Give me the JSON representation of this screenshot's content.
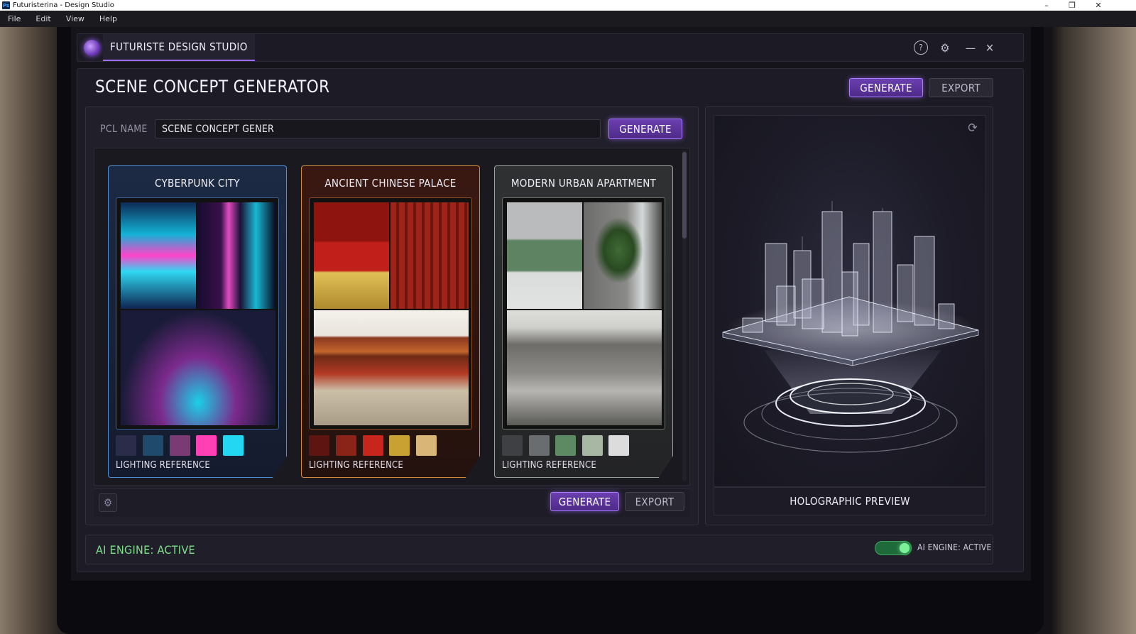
{
  "window": {
    "app_badge": "Ps",
    "title": "Futuristerina - Design Studio"
  },
  "menubar": {
    "items": [
      "File",
      "Edit",
      "View",
      "Help"
    ]
  },
  "app": {
    "tab_title": "FUTURISTE DESIGN STUDIO"
  },
  "page": {
    "title": "SCENE CONCEPT GENERATOR",
    "generate_label": "GENERATE",
    "export_label": "EXPORT"
  },
  "form": {
    "pcl_label": "PCL NAME",
    "pcl_value": "SCENE CONCEPT GENER",
    "generate_label": "GENERATE"
  },
  "cards": [
    {
      "title": "CYBERPUNK CITY",
      "footer": "LIGHTING REFERENCE",
      "accent": "#4a8fd8",
      "swatches": [
        "#2a2c4a",
        "#1f4a6c",
        "#7a3a74",
        "#ff3fb3",
        "#23d7f0"
      ]
    },
    {
      "title": "ANCIENT CHINESE PALACE",
      "footer": "LIGHTING REFERENCE",
      "accent": "#d5893a",
      "swatches": [
        "#5e1410",
        "#8a2418",
        "#c8261d",
        "#c9a133",
        "#d8b678"
      ]
    },
    {
      "title": "MODERN URBAN APARTMENT",
      "footer": "LIGHTING REFERENCE",
      "accent": "#9aa39a",
      "swatches": [
        "#3e4043",
        "#6a6d70",
        "#5d8a62",
        "#a7b7a4",
        "#dcdcdc"
      ]
    }
  ],
  "bottom_bar": {
    "generate_label": "GENERATE",
    "export_label": "EXPORT"
  },
  "preview": {
    "label": "HOLOGRAPHIC PREVIEW"
  },
  "status": {
    "text": "AI ENGINE: ACTIVE",
    "toggle_label": "AI ENGINE: ACTIVE",
    "toggle_on": true
  },
  "icons": {
    "logo": "spiral-logo-icon",
    "help": "question-circle-icon",
    "settings": "gear-icon",
    "minimize": "minimize-icon",
    "close": "close-icon",
    "refresh": "refresh-icon"
  }
}
